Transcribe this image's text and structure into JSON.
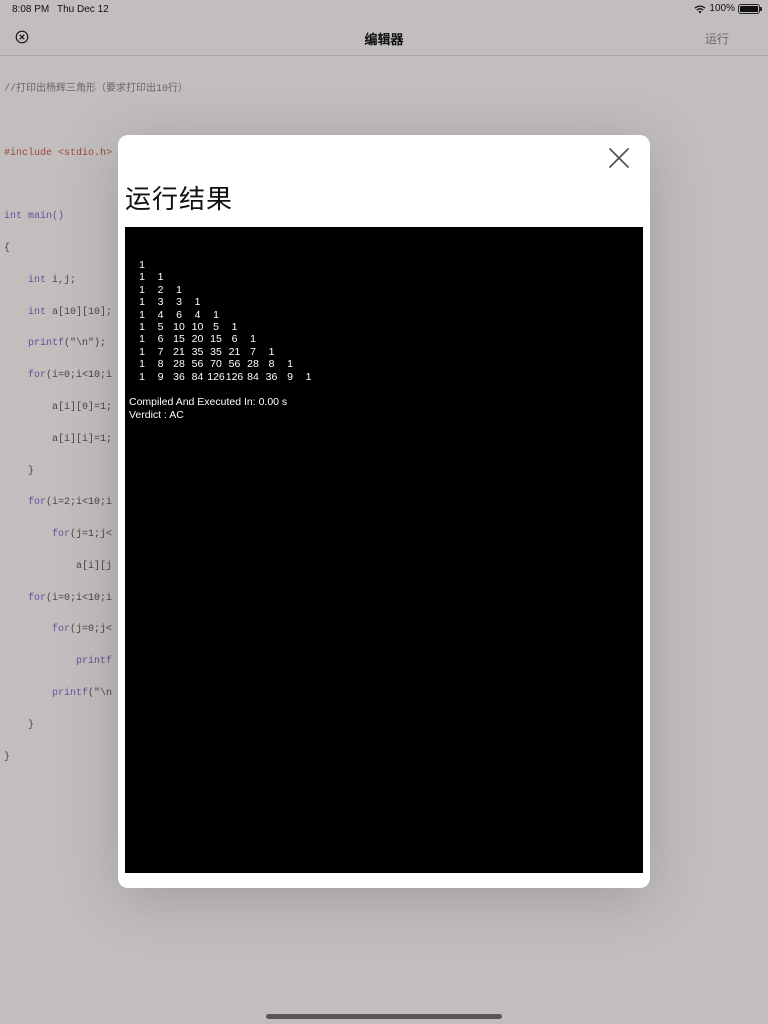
{
  "status": {
    "time": "8:08 PM",
    "date": "Thu Dec 12",
    "battery": "100%"
  },
  "nav": {
    "title": "编辑器",
    "run_label": "运行"
  },
  "code": {
    "comment": "//打印出杨辉三角形（要求打印出10行）",
    "include": "#include <stdio.h>",
    "lines": [
      "int main()",
      "{",
      "    int i,j;",
      "    int a[10][10];",
      "    printf(\"\\n\");",
      "    for(i=0;i<10;i",
      "        a[i][0]=1;",
      "        a[i][i]=1;",
      "    }",
      "    for(i=2;i<10;i",
      "        for(j=1;j<",
      "            a[i][j",
      "    for(i=0;i<10;i",
      "        for(j=0;j<",
      "            printf",
      "        printf(\"\\n",
      "    }",
      "}"
    ]
  },
  "modal": {
    "title": "运行结果",
    "output_rows": [
      [
        "1"
      ],
      [
        "1",
        "1"
      ],
      [
        "1",
        "2",
        "1"
      ],
      [
        "1",
        "3",
        "3",
        "1"
      ],
      [
        "1",
        "4",
        "6",
        "4",
        "1"
      ],
      [
        "1",
        "5",
        "10",
        "10",
        "5",
        "1"
      ],
      [
        "1",
        "6",
        "15",
        "20",
        "15",
        "6",
        "1"
      ],
      [
        "1",
        "7",
        "21",
        "35",
        "35",
        "21",
        "7",
        "1"
      ],
      [
        "1",
        "8",
        "28",
        "56",
        "70",
        "56",
        "28",
        "8",
        "1"
      ],
      [
        "1",
        "9",
        "36",
        "84",
        "126",
        "126",
        "84",
        "36",
        "9",
        "1"
      ]
    ],
    "compile_info": "Compiled And Executed In: 0.00 s",
    "verdict": "Verdict : AC"
  }
}
